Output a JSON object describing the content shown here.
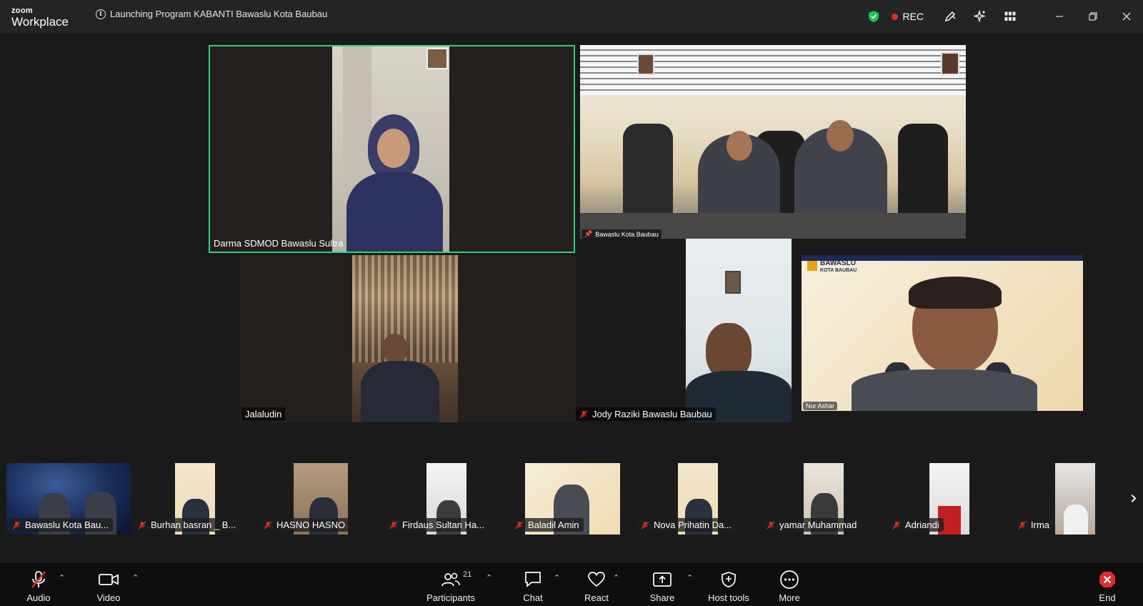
{
  "app": {
    "logo_line1": "zoom",
    "logo_line2": "Workplace"
  },
  "meeting": {
    "title": "Launching Program KABANTI Bawaslu Kota Baubau"
  },
  "titlebar": {
    "rec_label": "REC"
  },
  "colors": {
    "active_speaker_border": "#2fd27a",
    "rec_dot": "#e02b2b",
    "shield": "#1fbf5a",
    "end_icon": "#e02b2b"
  },
  "gallery": [
    {
      "name": "Darma SDMOD Bawaslu Sultra",
      "muted": false,
      "active": true
    },
    {
      "name": "Bawaslu Kota Baubau",
      "muted": false,
      "pinned": true
    },
    {
      "name": "Jalaludin",
      "muted": false
    },
    {
      "name": "Jody Raziki Bawaslu Baubau",
      "muted": true
    },
    {
      "name": "Nur Ashar",
      "muted": false
    }
  ],
  "filmstrip": [
    {
      "name": "Bawaslu Kota Bau..."
    },
    {
      "name": "Burhan basran _ B..."
    },
    {
      "name": "HASNO HASNO"
    },
    {
      "name": "Firdaus Sultan Ha..."
    },
    {
      "name": "Baladil Amin"
    },
    {
      "name": "Nova Prihatin Da..."
    },
    {
      "name": "yamar Muhammad"
    },
    {
      "name": "Adriandi"
    },
    {
      "name": "Irma"
    }
  ],
  "toolbar": {
    "audio": "Audio",
    "video": "Video",
    "participants": "Participants",
    "participants_count": "21",
    "chat": "Chat",
    "react": "React",
    "share": "Share",
    "host_tools": "Host tools",
    "more": "More",
    "end": "End"
  }
}
